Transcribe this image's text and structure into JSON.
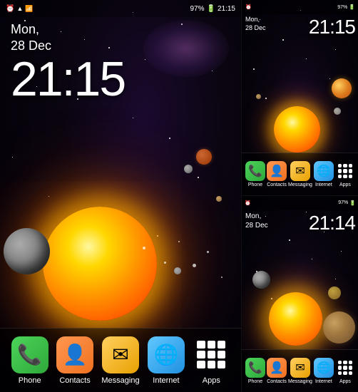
{
  "left": {
    "status": {
      "alarm_icon": "🔔",
      "battery_percent": "97%",
      "time_display": "21:15"
    },
    "date_line1": "Mon,",
    "date_line2": "28 Dec",
    "time": "21:15",
    "dock": [
      {
        "id": "phone",
        "label": "Phone",
        "icon": "📞",
        "type": "phone"
      },
      {
        "id": "contacts",
        "label": "Contacts",
        "icon": "👤",
        "type": "contacts"
      },
      {
        "id": "messaging",
        "label": "Messaging",
        "icon": "✉",
        "type": "messaging"
      },
      {
        "id": "internet",
        "label": "Internet",
        "icon": "🌐",
        "type": "internet"
      },
      {
        "id": "apps",
        "label": "Apps",
        "type": "apps"
      }
    ]
  },
  "right_top": {
    "date_line1": "Mon,",
    "date_line2": "28 Dec",
    "time": "21:15",
    "dock": [
      {
        "id": "phone",
        "label": "Phone",
        "type": "phone"
      },
      {
        "id": "contacts",
        "label": "Contacts",
        "type": "contacts"
      },
      {
        "id": "messaging",
        "label": "Messaging",
        "type": "messaging"
      },
      {
        "id": "internet",
        "label": "Internet",
        "type": "internet"
      },
      {
        "id": "apps",
        "label": "Apps",
        "type": "apps"
      }
    ]
  },
  "right_bottom": {
    "date_line1": "Mon,",
    "date_line2": "28 Dec",
    "time": "21:14",
    "dock": [
      {
        "id": "phone",
        "label": "Phone",
        "type": "phone"
      },
      {
        "id": "contacts",
        "label": "Contacts",
        "type": "contacts"
      },
      {
        "id": "messaging",
        "label": "Messaging",
        "type": "messaging"
      },
      {
        "id": "internet",
        "label": "Internet",
        "type": "internet"
      },
      {
        "id": "apps",
        "label": "Apps",
        "type": "apps"
      }
    ]
  }
}
